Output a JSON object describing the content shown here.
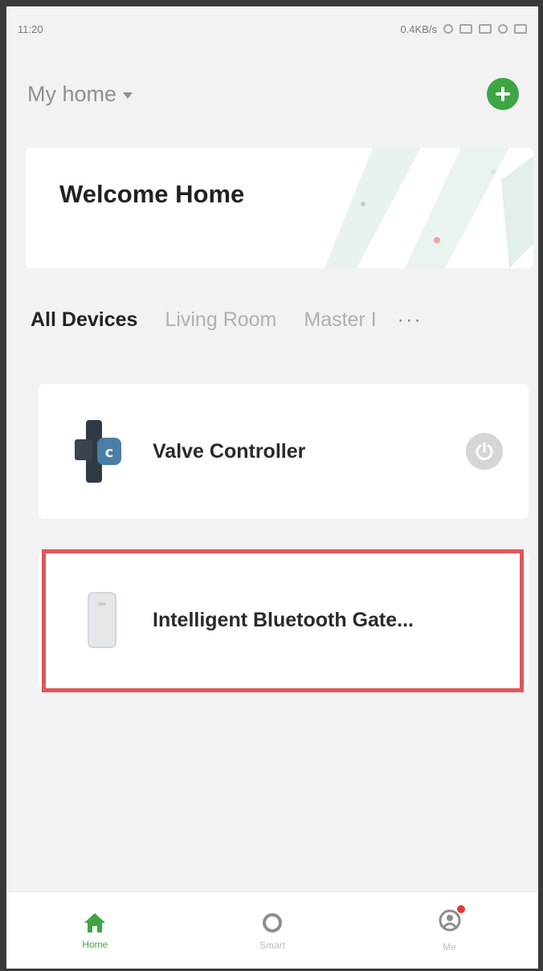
{
  "status_bar": {
    "time": "11:20",
    "right_text": "0.4KB/s"
  },
  "header": {
    "home_name": "My home",
    "add_icon": "plus-icon"
  },
  "welcome": {
    "title": "Welcome Home"
  },
  "tabs": [
    {
      "label": "All Devices",
      "active": true
    },
    {
      "label": "Living Room",
      "active": false
    },
    {
      "label": "Master I",
      "active": false
    }
  ],
  "tabs_more": "···",
  "devices": [
    {
      "name": "Valve Controller",
      "icon": "valve-icon",
      "has_power": true
    },
    {
      "name": "Intelligent Bluetooth Gate...",
      "icon": "gateway-icon",
      "has_power": false
    }
  ],
  "bottom_nav": [
    {
      "label": "Home",
      "icon": "home-icon",
      "active": true
    },
    {
      "label": "Smart",
      "icon": "smart-icon",
      "active": false
    },
    {
      "label": "Me",
      "icon": "profile-icon",
      "active": false
    }
  ],
  "colors": {
    "accent": "#3da643",
    "highlight": "#e0555a",
    "background": "#f2f2f2"
  }
}
